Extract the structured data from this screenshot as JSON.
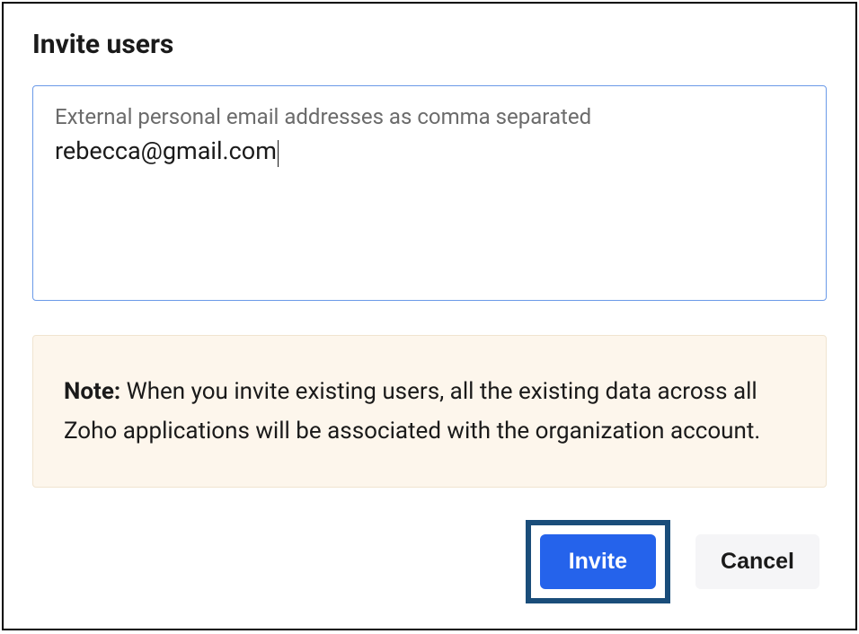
{
  "dialog": {
    "title": "Invite users",
    "email_input": {
      "label": "External personal email addresses as comma separated",
      "value": "rebecca@gmail.com"
    },
    "note": {
      "prefix": "Note:",
      "text": " When you invite existing users, all the existing data across all Zoho applications will be associated with the organization account."
    },
    "buttons": {
      "invite": "Invite",
      "cancel": "Cancel"
    }
  }
}
